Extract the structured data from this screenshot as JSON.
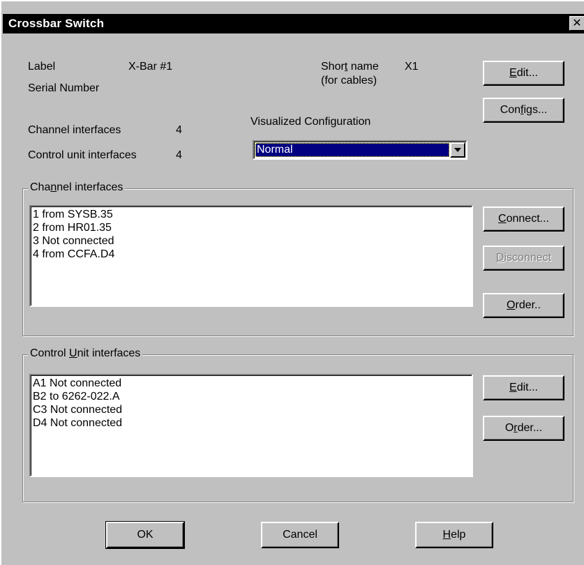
{
  "window": {
    "title": "Crossbar Switch",
    "close_glyph": "✕"
  },
  "info": {
    "label_caption": "Label",
    "label_value": "X-Bar #1",
    "serial_caption": "Serial Number",
    "short_name_caption_pre": "Shor",
    "short_name_caption_key": "t",
    "short_name_caption_post": " name",
    "short_name_sub": "(for cables)",
    "short_name_value": "X1",
    "channel_count_caption": "Channel interfaces",
    "channel_count_value": "4",
    "cu_count_caption": "Control unit interfaces",
    "cu_count_value": "4"
  },
  "visualized": {
    "caption": "Visualized Configuration",
    "selected": "Normal"
  },
  "buttons": {
    "edit_key": "E",
    "edit_rest": "dit...",
    "configs_pre": "Con",
    "configs_key": "f",
    "configs_post": "igs...",
    "connect_key": "C",
    "connect_rest": "onnect...",
    "disconnect_key": "D",
    "disconnect_rest": "isconnect",
    "order1_key": "O",
    "order1_rest": "rder..",
    "cu_edit_key": "E",
    "cu_edit_rest": "dit...",
    "order2_pre": "O",
    "order2_key": "r",
    "order2_post": "der...",
    "ok": "OK",
    "cancel": "Cancel",
    "help_key": "H",
    "help_rest": "elp"
  },
  "channel_group": {
    "label_pre": "Cha",
    "label_key": "n",
    "label_post": "nel interfaces",
    "items": [
      "1 from SYSB.35",
      "2 from HR01.35",
      "3 Not connected",
      "4 from CCFA.D4"
    ]
  },
  "cu_group": {
    "label_pre": "Control ",
    "label_key": "U",
    "label_post": "nit interfaces",
    "items": [
      "A1 Not connected",
      "B2 to 6262-022.A",
      "C3 Not connected",
      "D4 Not connected"
    ]
  },
  "icons": {
    "dropdown": "chevron-down-icon",
    "close": "close-icon"
  }
}
